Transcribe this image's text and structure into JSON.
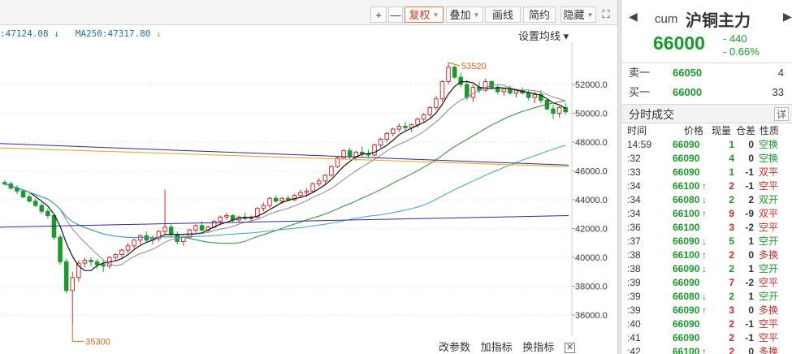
{
  "toolbar": {
    "buttons": [
      {
        "label": "+",
        "kind": "plain"
      },
      {
        "label": "—",
        "kind": "plain"
      },
      {
        "label": "复权",
        "kind": "dropdown-active"
      },
      {
        "label": "叠加",
        "kind": "dropdown"
      },
      {
        "label": "画线",
        "kind": "plain"
      },
      {
        "label": "简约",
        "kind": "plain"
      },
      {
        "label": "隐藏",
        "kind": "dropdown"
      }
    ],
    "expand_icon": "expand-icon"
  },
  "ma_legend": {
    "ma248_text": ":47124.08",
    "ma248_arrow": "↓",
    "ma250_text": "MA250:47317.80",
    "ma250_arrow": "↓"
  },
  "ma_setting_label": "设置均线 ▾",
  "chart_data": {
    "type": "candlestick",
    "yaxis_ticks": [
      "52000.0",
      "50000.0",
      "48000.0",
      "46000.0",
      "44000.0",
      "42000.0",
      "40000.0",
      "38000.0",
      "36000.0"
    ],
    "ylim": [
      34500,
      55000
    ],
    "annotations": [
      {
        "label": "53520",
        "value": 53520
      },
      {
        "label": "35300",
        "value": 35300
      }
    ],
    "colors": {
      "up": "#d12a2a",
      "down": "#1a9a2a",
      "ma_black": "#111111",
      "ma_gray": "#888888",
      "ma_green": "#2e8b2e",
      "ma_orange": "#e8a317",
      "ma_lightblue": "#3aa0d0",
      "ma_navy": "#2b2b9a"
    },
    "candles": [
      [
        45200,
        45350,
        45000,
        45100
      ],
      [
        45100,
        45250,
        44700,
        44800
      ],
      [
        44800,
        45000,
        44400,
        44600
      ],
      [
        44600,
        44700,
        44100,
        44200
      ],
      [
        44200,
        44400,
        43800,
        43900
      ],
      [
        43900,
        44100,
        43500,
        43600
      ],
      [
        43600,
        43800,
        43000,
        43200
      ],
      [
        43200,
        43400,
        42700,
        42900
      ],
      [
        42900,
        43000,
        41200,
        41400
      ],
      [
        41400,
        41600,
        39500,
        39700
      ],
      [
        39700,
        39900,
        37500,
        37700
      ],
      [
        37700,
        39000,
        35300,
        38600
      ],
      [
        38600,
        39800,
        38300,
        39600
      ],
      [
        39600,
        40000,
        39300,
        39800
      ],
      [
        39800,
        40000,
        39400,
        39700
      ],
      [
        39700,
        39900,
        39200,
        39500
      ],
      [
        39500,
        39800,
        39000,
        39400
      ],
      [
        39400,
        40100,
        39200,
        40000
      ],
      [
        40000,
        40300,
        39800,
        40200
      ],
      [
        40200,
        40600,
        40000,
        40500
      ],
      [
        40500,
        41000,
        40300,
        40800
      ],
      [
        40800,
        41300,
        40600,
        41200
      ],
      [
        41200,
        41600,
        40900,
        41500
      ],
      [
        41500,
        41800,
        41000,
        41200
      ],
      [
        41200,
        41500,
        40900,
        41300
      ],
      [
        41300,
        41900,
        41100,
        41800
      ],
      [
        41800,
        44700,
        41600,
        42100
      ],
      [
        42100,
        42300,
        41400,
        41600
      ],
      [
        41600,
        41800,
        40900,
        41100
      ],
      [
        41100,
        41500,
        40800,
        41400
      ],
      [
        41400,
        42000,
        41300,
        41900
      ],
      [
        41900,
        42300,
        41700,
        42200
      ],
      [
        42200,
        42500,
        41800,
        41900
      ],
      [
        41900,
        42200,
        41700,
        42100
      ],
      [
        42100,
        42600,
        42000,
        42500
      ],
      [
        42500,
        42900,
        42300,
        42800
      ],
      [
        42800,
        43100,
        42600,
        42900
      ],
      [
        42900,
        43000,
        42400,
        42600
      ],
      [
        42600,
        42900,
        42400,
        42800
      ],
      [
        42800,
        43100,
        42600,
        42700
      ],
      [
        42700,
        42900,
        42500,
        42800
      ],
      [
        42800,
        43500,
        42700,
        43400
      ],
      [
        43400,
        43800,
        43200,
        43600
      ],
      [
        43600,
        44200,
        43400,
        44100
      ],
      [
        44100,
        44300,
        43800,
        43900
      ],
      [
        43900,
        44200,
        43700,
        44100
      ],
      [
        44100,
        44300,
        43900,
        44000
      ],
      [
        44000,
        44400,
        43900,
        44300
      ],
      [
        44300,
        44700,
        44100,
        44500
      ],
      [
        44500,
        44800,
        44200,
        44600
      ],
      [
        44600,
        45200,
        44500,
        45100
      ],
      [
        45100,
        45500,
        44900,
        45300
      ],
      [
        45300,
        45800,
        45100,
        45700
      ],
      [
        45700,
        46400,
        45600,
        46300
      ],
      [
        46300,
        47000,
        46200,
        46900
      ],
      [
        46900,
        47500,
        46800,
        47400
      ],
      [
        47400,
        47600,
        46800,
        47000
      ],
      [
        47000,
        47400,
        46700,
        47300
      ],
      [
        47300,
        47700,
        47000,
        47200
      ],
      [
        47200,
        47500,
        46900,
        47100
      ],
      [
        47100,
        47900,
        47000,
        47800
      ],
      [
        47800,
        48300,
        47600,
        48200
      ],
      [
        48200,
        48700,
        48000,
        48600
      ],
      [
        48600,
        49000,
        48400,
        48900
      ],
      [
        48900,
        49300,
        48700,
        49100
      ],
      [
        49100,
        49400,
        48800,
        49000
      ],
      [
        49000,
        49300,
        48700,
        49200
      ],
      [
        49200,
        49700,
        49000,
        49600
      ],
      [
        49600,
        50000,
        49400,
        49900
      ],
      [
        49900,
        50500,
        49700,
        50400
      ],
      [
        50400,
        51200,
        50200,
        51000
      ],
      [
        51000,
        52300,
        50800,
        52200
      ],
      [
        52200,
        53520,
        52000,
        53200
      ],
      [
        53200,
        53300,
        52400,
        52500
      ],
      [
        52500,
        52800,
        51800,
        52000
      ],
      [
        52000,
        52300,
        50900,
        51100
      ],
      [
        51100,
        52000,
        50800,
        51800
      ],
      [
        51800,
        52200,
        51400,
        51600
      ],
      [
        51600,
        52400,
        51500,
        52200
      ],
      [
        52200,
        52300,
        51700,
        51800
      ],
      [
        51800,
        52000,
        51300,
        51500
      ],
      [
        51500,
        51800,
        51200,
        51700
      ],
      [
        51700,
        51900,
        51300,
        51400
      ],
      [
        51400,
        51700,
        51100,
        51600
      ],
      [
        51600,
        51800,
        51300,
        51400
      ],
      [
        51400,
        51600,
        50900,
        51100
      ],
      [
        51100,
        51500,
        50700,
        51300
      ],
      [
        51300,
        51600,
        50700,
        50900
      ],
      [
        50900,
        51000,
        50200,
        50300
      ],
      [
        50300,
        50600,
        49600,
        50000
      ],
      [
        50000,
        50500,
        49700,
        50400
      ],
      [
        50400,
        50700,
        49900,
        50100
      ]
    ]
  },
  "quote": {
    "prev_icon": "prev-icon",
    "next_icon": "next-icon",
    "code": "cum",
    "name": "沪铜主力",
    "price": "66000",
    "change": "- 440",
    "change_pct": "- 0.66%"
  },
  "orderbook": [
    {
      "label": "卖一",
      "price": "66050",
      "vol": "4"
    },
    {
      "label": "买一",
      "price": "66000",
      "vol": "33"
    }
  ],
  "ticks": {
    "title": "分时成交",
    "detail_label": "详",
    "columns": [
      "时间",
      "价格",
      "现量",
      "仓差",
      "性质"
    ],
    "rows": [
      {
        "time": "14:59",
        "price": "66090",
        "pc": "green",
        "arrow": "",
        "vol": "1",
        "vc": "green",
        "oi": "0",
        "nature": "空换",
        "nc": "green"
      },
      {
        "time": ":32",
        "price": "66090",
        "pc": "green",
        "arrow": "",
        "vol": "4",
        "vc": "green",
        "oi": "0",
        "nature": "空换",
        "nc": "green"
      },
      {
        "time": ":33",
        "price": "66090",
        "pc": "green",
        "arrow": "",
        "vol": "1",
        "vc": "green",
        "oi": "-1",
        "nature": "双平",
        "nc": "red"
      },
      {
        "time": ":34",
        "price": "66100",
        "pc": "green",
        "arrow": "↑",
        "vol": "2",
        "vc": "red",
        "oi": "-1",
        "nature": "空平",
        "nc": "red"
      },
      {
        "time": ":34",
        "price": "66080",
        "pc": "green",
        "arrow": "↓",
        "vol": "2",
        "vc": "green",
        "oi": "2",
        "nature": "双开",
        "nc": "green"
      },
      {
        "time": ":34",
        "price": "66100",
        "pc": "green",
        "arrow": "↑",
        "vol": "9",
        "vc": "red",
        "oi": "-9",
        "nature": "双平",
        "nc": "red"
      },
      {
        "time": ":36",
        "price": "66100",
        "pc": "green",
        "arrow": "",
        "vol": "3",
        "vc": "red",
        "oi": "-2",
        "nature": "空平",
        "nc": "red"
      },
      {
        "time": ":37",
        "price": "66090",
        "pc": "green",
        "arrow": "↓",
        "vol": "5",
        "vc": "green",
        "oi": "1",
        "nature": "空开",
        "nc": "green"
      },
      {
        "time": ":38",
        "price": "66100",
        "pc": "green",
        "arrow": "↑",
        "vol": "2",
        "vc": "red",
        "oi": "0",
        "nature": "多换",
        "nc": "red"
      },
      {
        "time": ":38",
        "price": "66090",
        "pc": "green",
        "arrow": "↓",
        "vol": "2",
        "vc": "green",
        "oi": "1",
        "nature": "空开",
        "nc": "green"
      },
      {
        "time": ":39",
        "price": "66090",
        "pc": "green",
        "arrow": "",
        "vol": "7",
        "vc": "red",
        "oi": "-2",
        "nature": "空平",
        "nc": "red"
      },
      {
        "time": ":39",
        "price": "66080",
        "pc": "green",
        "arrow": "↓",
        "vol": "2",
        "vc": "green",
        "oi": "1",
        "nature": "空开",
        "nc": "green"
      },
      {
        "time": ":39",
        "price": "66090",
        "pc": "green",
        "arrow": "↑",
        "vol": "3",
        "vc": "red",
        "oi": "0",
        "nature": "多换",
        "nc": "red"
      },
      {
        "time": ":40",
        "price": "66090",
        "pc": "green",
        "arrow": "",
        "vol": "2",
        "vc": "red",
        "oi": "-1",
        "nature": "空平",
        "nc": "red"
      },
      {
        "time": ":41",
        "price": "66090",
        "pc": "green",
        "arrow": "",
        "vol": "2",
        "vc": "red",
        "oi": "-1",
        "nature": "空平",
        "nc": "red"
      },
      {
        "time": ":42",
        "price": "66100",
        "pc": "green",
        "arrow": "↑",
        "vol": "2",
        "vc": "red",
        "oi": "0",
        "nature": "多换",
        "nc": "red"
      }
    ]
  },
  "indicator_bar": {
    "labels": [
      "改参数",
      "加指标",
      "换指标"
    ],
    "close_label": "✕"
  }
}
